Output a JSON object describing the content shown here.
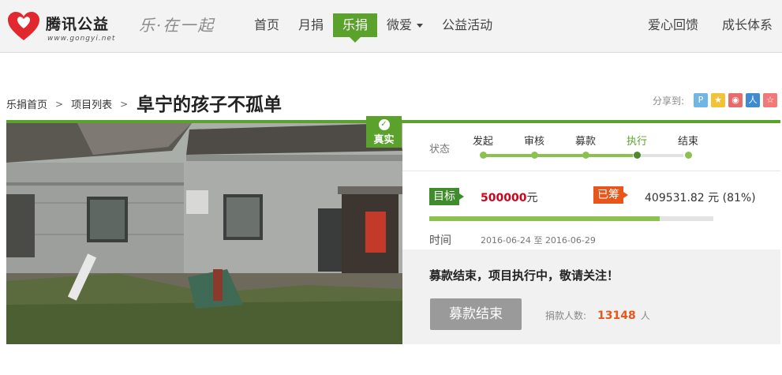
{
  "header": {
    "brand": "腾讯公益",
    "url": "www.gongyi.net",
    "slogan": "乐·在一起",
    "nav": [
      {
        "label": "首页"
      },
      {
        "label": "月捐"
      },
      {
        "label": "乐捐",
        "active": true
      },
      {
        "label": "微爱"
      },
      {
        "label": "公益活动"
      }
    ],
    "nav_right": [
      {
        "label": "爱心回馈"
      },
      {
        "label": "成长体系"
      }
    ]
  },
  "breadcrumb": {
    "items": [
      "乐捐首页",
      "项目列表"
    ],
    "title": "阜宁的孩子不孤单"
  },
  "share": {
    "label": "分享到:",
    "icons": [
      {
        "name": "qzone-icon",
        "glyph": "P",
        "color": "#6fb5e6"
      },
      {
        "name": "star-icon",
        "glyph": "★",
        "color": "#f2c338"
      },
      {
        "name": "weibo-icon",
        "glyph": "◉",
        "color": "#e96a6a"
      },
      {
        "name": "renren-icon",
        "glyph": "人",
        "color": "#3f8bd2"
      },
      {
        "name": "favorite-icon",
        "glyph": "☆",
        "color": "#f07a7a"
      }
    ]
  },
  "project": {
    "badge": "真实",
    "status_label": "状态",
    "steps": [
      "发起",
      "审核",
      "募款",
      "执行",
      "结束"
    ],
    "current_step": 3,
    "goal_label": "目标",
    "goal_amount": "500000",
    "goal_unit": "元",
    "raised_label": "已筹",
    "raised_text": "409531.82 元 (81%)",
    "progress_fraction": 0.81,
    "time_label": "时间",
    "start_date": "2016-06-24",
    "date_sep": "至",
    "end_date": "2016-06-29",
    "status_message": "募款结束，项目执行中，敬请关注！",
    "end_button": "募款结束",
    "donors_label": "捐款人数:",
    "donors_count": "13148",
    "donors_unit": "人"
  },
  "colors": {
    "accent": "#5aa22c",
    "progress": "#8cc152",
    "raised": "#e8561c",
    "goal_amount": "#d0021b"
  }
}
